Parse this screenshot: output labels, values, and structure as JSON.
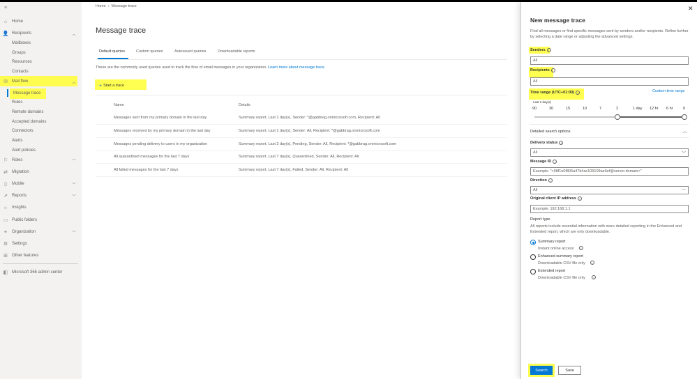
{
  "nav": {
    "items": [
      {
        "label": "Home",
        "icon": "home-icon",
        "glyph": "⌂"
      },
      {
        "label": "Recipients",
        "icon": "person-icon",
        "glyph": "👤"
      },
      {
        "label": "Mail flow",
        "icon": "mail-icon",
        "glyph": "✉"
      },
      {
        "label": "Roles",
        "icon": "roles-icon",
        "glyph": "⚐"
      },
      {
        "label": "Migration",
        "icon": "migration-icon",
        "glyph": "⇄"
      },
      {
        "label": "Mobile",
        "icon": "mobile-icon",
        "glyph": "▯"
      },
      {
        "label": "Reports",
        "icon": "reports-icon",
        "glyph": "⇗"
      },
      {
        "label": "Insights",
        "icon": "insights-icon",
        "glyph": "☼"
      },
      {
        "label": "Public folders",
        "icon": "folder-icon",
        "glyph": "▭"
      },
      {
        "label": "Organization",
        "icon": "organization-icon",
        "glyph": "⚭"
      },
      {
        "label": "Settings",
        "icon": "gear-icon",
        "glyph": "⚙"
      },
      {
        "label": "Other features",
        "icon": "grid-icon",
        "glyph": "⊞"
      },
      {
        "label": "Microsoft 365 admin center",
        "icon": "office-icon",
        "glyph": "◧"
      }
    ],
    "recipients_sub": [
      "Mailboxes",
      "Groups",
      "Resources",
      "Contacts"
    ],
    "mailflow_sub": [
      "Message trace",
      "Rules",
      "Remote domains",
      "Accepted domains",
      "Connectors",
      "Alerts",
      "Alert policies"
    ]
  },
  "main": {
    "breadcrumb": [
      "Home",
      "Message trace"
    ],
    "title": "Message trace",
    "tabs": [
      "Default queries",
      "Custom queries",
      "Autosaved queries",
      "Downloadable reports"
    ],
    "description": "These are the commonly used queries used to track the flow of email messages in your organization.",
    "learn_more": "Learn more about message trace",
    "start_trace": "Start a trace",
    "columns": [
      "Name",
      "Details"
    ],
    "rows": [
      {
        "name": "Messages sent from my primary domain in the last day",
        "details": "Summary report, Last 1 day(s), Sender: *@gabbrag.onmicrosoft.com, Recipient: All"
      },
      {
        "name": "Messages received by my primary domain in the last day",
        "details": "Summary report, Last 1 day(s), Sender: All, Recipient: *@gabbrag.onmicrosoft.com"
      },
      {
        "name": "Messages pending delivery to users in my organization",
        "details": "Summary report, Last 2 day(s), Pending, Sender: All, Recipient: *@gabbrag.onmicrosoft.com"
      },
      {
        "name": "All quarantined messages for the last 7 days",
        "details": "Summary report, Last 7 day(s), Quarantined, Sender: All, Recipient: All"
      },
      {
        "name": "All failed messages for the last 7 days",
        "details": "Summary report, Last 7 day(s), Failed, Sender: All, Recipient: All"
      }
    ]
  },
  "panel": {
    "title": "New message trace",
    "description": "Find all messages or find specific messages sent by senders and/or recipients. Refine further by selecting a date range or adjusting the advanced settings.",
    "senders_label": "Senders",
    "senders_value": "All",
    "recipients_label": "Recipients",
    "recipients_value": "All",
    "time_range_label": "Time range (UTC+01:00)",
    "custom_time_range": "Custom time range",
    "slider_caption": "Last 2 day(s)",
    "slider_labels": [
      "90",
      "30",
      "15",
      "10",
      "7",
      "2",
      "1 day",
      "12 hr",
      "6 hr",
      "0"
    ],
    "slider_selected_days": 2,
    "detailed_options": "Detailed search options",
    "delivery_status_label": "Delivery status",
    "delivery_status_value": "All",
    "message_id_label": "Message ID",
    "message_id_placeholder": "Example: \"<08f1e0f806a47b4ac109109ae6ef@server.domain>\"",
    "direction_label": "Direction",
    "direction_value": "All",
    "client_ip_label": "Original client IP address",
    "client_ip_placeholder": "Example: 192.168.1.1",
    "report_type_label": "Report type",
    "report_type_desc": "All reports include essential information with more detailed reporting in the Enhanced and Extended report, which are only downloadable.",
    "reports": [
      {
        "label": "Summary report",
        "sub": "Instant online access",
        "selected": true
      },
      {
        "label": "Enhanced summary report",
        "sub": "Downloadable CSV file only",
        "selected": false
      },
      {
        "label": "Extended report",
        "sub": "Downloadable CSV file only",
        "selected": false
      }
    ],
    "search_button": "Search",
    "save_button": "Save"
  },
  "colors": {
    "accent": "#0078d4",
    "highlight": "#ffff33",
    "nav_bg": "#f3f2f1"
  }
}
